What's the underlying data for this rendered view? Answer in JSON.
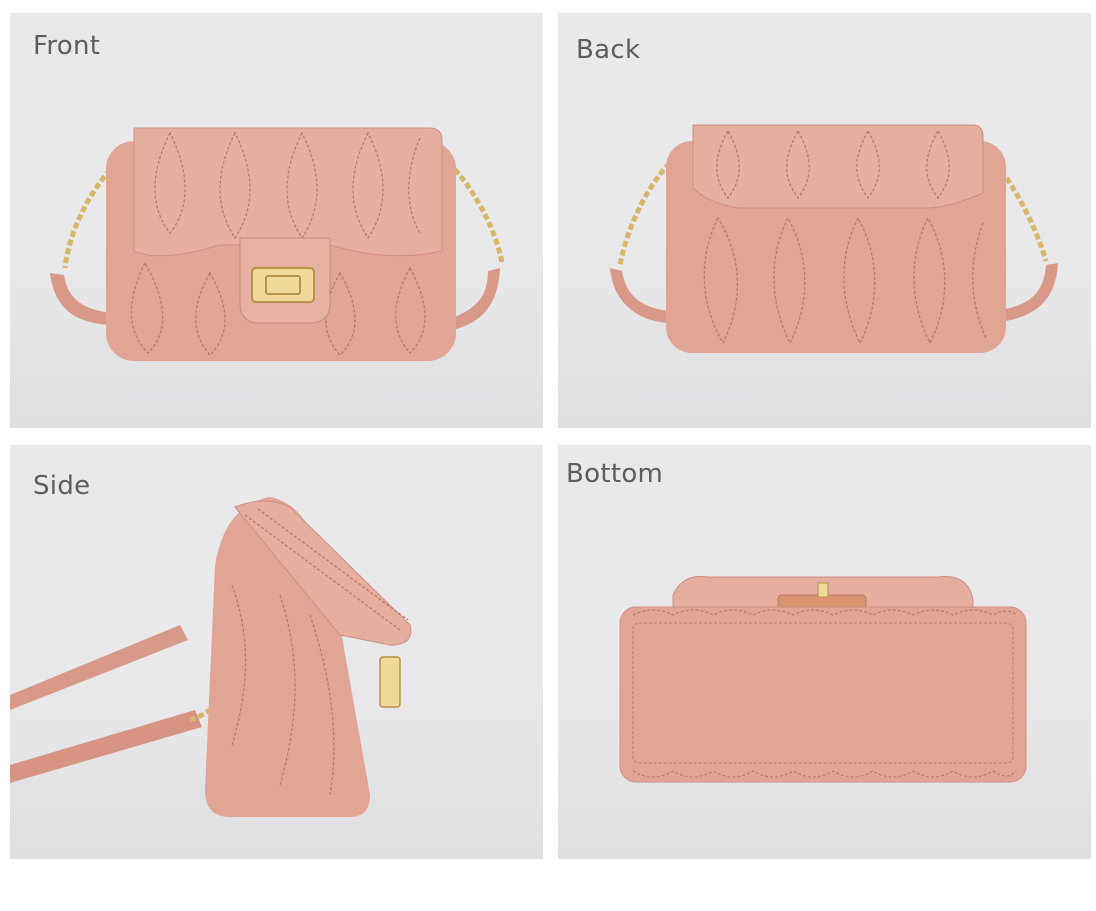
{
  "panels": [
    {
      "id": "front",
      "label": "Front"
    },
    {
      "id": "back",
      "label": "Back"
    },
    {
      "id": "side",
      "label": "Side"
    },
    {
      "id": "bottom",
      "label": "Bottom"
    }
  ],
  "colors": {
    "background": "#e9e9eb",
    "leather": "#e1a596",
    "leather_dark": "#c9877a",
    "stitch": "#b8776a",
    "gold": "#d8b66a",
    "label_text": "#5d5d5d"
  }
}
